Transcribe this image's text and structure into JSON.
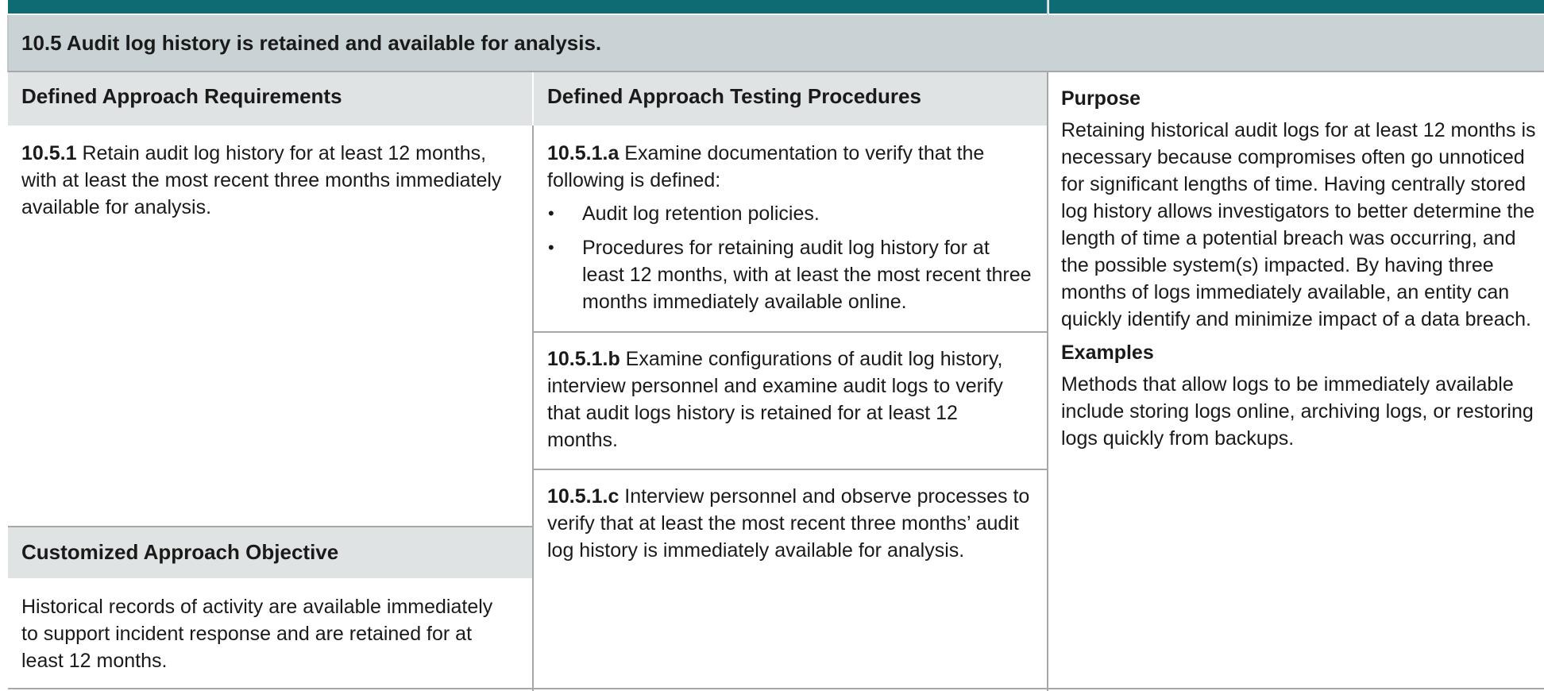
{
  "section": {
    "title": "10.5 Audit log history is retained and available for analysis."
  },
  "columns": {
    "requirements_header": "Defined Approach Requirements",
    "testing_header": "Defined Approach Testing Procedures",
    "customized_header": "Customized Approach Objective"
  },
  "requirement": {
    "id": "10.5.1",
    "text": " Retain audit log history for at least 12 months, with at least the most recent three months immediately available for analysis."
  },
  "customized_objective": {
    "text": "Historical records of activity are available immediately to support incident response and are retained for at least 12 months."
  },
  "testing_procedures": [
    {
      "id": "10.5.1.a",
      "text": " Examine documentation to verify that the following is defined:",
      "bullets": [
        "Audit log retention policies.",
        "Procedures for retaining audit log history for at least 12 months, with at least the most recent three months immediately available online."
      ]
    },
    {
      "id": "10.5.1.b",
      "text": " Examine configurations of audit log history, interview personnel and examine audit logs to verify that audit logs history is retained for at least 12 months."
    },
    {
      "id": "10.5.1.c",
      "text": " Interview personnel and observe processes to verify that at least the most recent three months’ audit log history is immediately available for analysis."
    }
  ],
  "guidance": {
    "purpose_heading": "Purpose",
    "purpose_text": "Retaining historical audit logs for at least 12 months is necessary because compromises often go unnoticed for significant lengths of time. Having centrally stored log history allows investigators to better determine the length of time a potential breach was occurring, and the possible system(s) impacted. By having three months of logs immediately available, an entity can quickly identify and minimize impact of a data breach.",
    "examples_heading": "Examples",
    "examples_text": "Methods that allow logs to be immediately available include storing logs online, archiving logs, or restoring logs quickly from backups."
  },
  "colors": {
    "teal_bar": "#0e6b73",
    "section_bg": "#c9d3d5",
    "column_header_bg": "#dfe3e4",
    "border": "#a7a7a7"
  }
}
